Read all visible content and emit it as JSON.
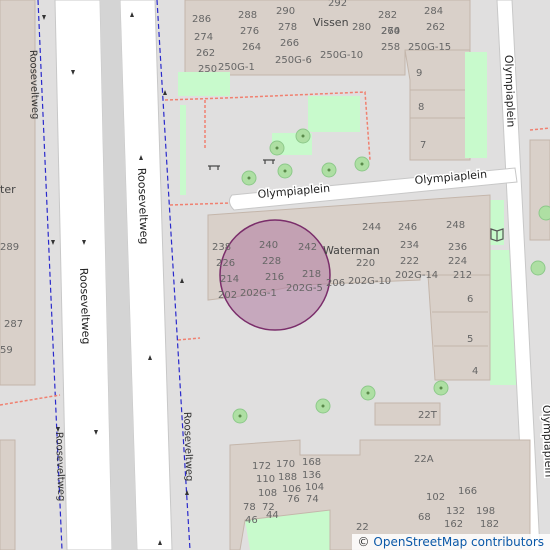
{
  "map": {
    "streets": {
      "olympiaplein_a": "Olympiaplein",
      "olympiaplein_b": "Olympiaplein",
      "olympiaplein_right_vertical": "Olympiaplein",
      "roosevelt_left": "Rooseveltweg",
      "roosevelt_mid": "Rooseveltweg",
      "roosevelt_bottom_left": "Rooseveltweg",
      "roosevelt_bottom_right": "Rooseveltweg",
      "olympiaplein_far_right": "Olympiaplein"
    },
    "buildings": {
      "vissen": "Vissen",
      "waterman": "Waterman",
      "left_partial": "ter"
    },
    "house_numbers": {
      "top_block": [
        "286",
        "288",
        "290",
        "292",
        "282",
        "284",
        "274",
        "276",
        "278",
        "280",
        "272",
        "262",
        "264",
        "266",
        "270",
        "250",
        "250G-1",
        "250G-6",
        "250G-10",
        "258",
        "250G-15"
      ],
      "right_column": [
        "9",
        "8",
        "7"
      ],
      "waterman": [
        "244",
        "246",
        "248",
        "238",
        "240",
        "242",
        "234",
        "236",
        "226",
        "228",
        "220",
        "222",
        "224",
        "214",
        "216",
        "218",
        "206",
        "212",
        "202",
        "202G-1",
        "202G-5",
        "202G-10",
        "202G-14"
      ],
      "right_lower": [
        "6",
        "5",
        "4"
      ],
      "small": "22T",
      "bottom_block": [
        "22A",
        "172",
        "170",
        "168",
        "110",
        "188",
        "136",
        "108",
        "106",
        "104",
        "72",
        "76",
        "74",
        "102",
        "166",
        "78",
        "46",
        "44",
        "132",
        "198",
        "22",
        "68",
        "162",
        "182",
        "186"
      ],
      "left_side": [
        "289",
        "287",
        "59"
      ]
    },
    "attribution": {
      "symbol": "©",
      "text": "OpenStreetMap contributors"
    },
    "colors": {
      "background": "#e0dfdf",
      "building": "#d9d0c9",
      "building_stroke": "#c4b6ab",
      "road": "#ffffff",
      "green": "#c8facc",
      "tree": "#aedfa3",
      "circle_fill": "#b07aa1",
      "circle_stroke": "#7a2d6a",
      "route_blue": "#0000cc",
      "path_red": "#f08070"
    }
  }
}
